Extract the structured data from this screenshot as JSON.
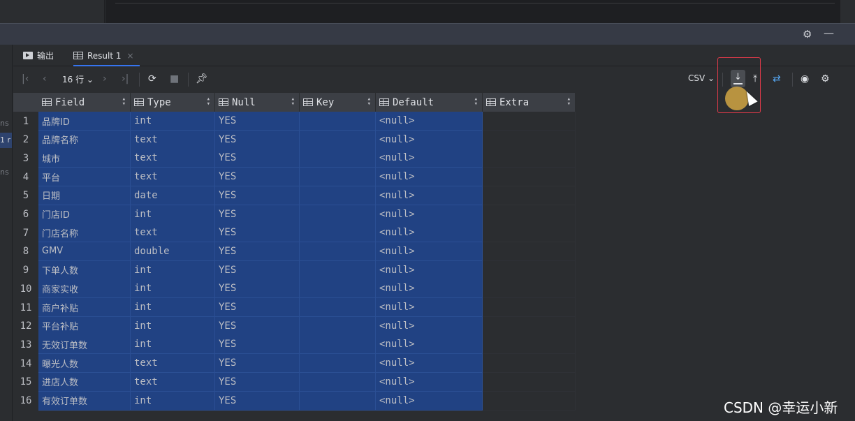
{
  "header": {
    "settings_icon": "gear-icon",
    "minimize_label": "—"
  },
  "tabs": [
    {
      "label": "输出",
      "icon": "console-icon"
    },
    {
      "label": "Result 1",
      "icon": "table-icon",
      "close": "×"
    }
  ],
  "toolbar": {
    "rows_label": "16 行",
    "format_label": "CSV"
  },
  "columns": [
    "Field",
    "Type",
    "Null",
    "Key",
    "Default",
    "Extra"
  ],
  "rows": [
    [
      "1",
      "品牌ID",
      "int",
      "YES",
      "",
      "<null>"
    ],
    [
      "2",
      "品牌名称",
      "text",
      "YES",
      "",
      "<null>"
    ],
    [
      "3",
      "城市",
      "text",
      "YES",
      "",
      "<null>"
    ],
    [
      "4",
      "平台",
      "text",
      "YES",
      "",
      "<null>"
    ],
    [
      "5",
      "日期",
      "date",
      "YES",
      "",
      "<null>"
    ],
    [
      "6",
      "门店ID",
      "int",
      "YES",
      "",
      "<null>"
    ],
    [
      "7",
      "门店名称",
      "text",
      "YES",
      "",
      "<null>"
    ],
    [
      "8",
      "GMV",
      "double",
      "YES",
      "",
      "<null>"
    ],
    [
      "9",
      "下单人数",
      "int",
      "YES",
      "",
      "<null>"
    ],
    [
      "10",
      "商家实收",
      "int",
      "YES",
      "",
      "<null>"
    ],
    [
      "11",
      "商户补贴",
      "int",
      "YES",
      "",
      "<null>"
    ],
    [
      "12",
      "平台补贴",
      "int",
      "YES",
      "",
      "<null>"
    ],
    [
      "13",
      "无效订单数",
      "int",
      "YES",
      "",
      "<null>"
    ],
    [
      "14",
      "曝光人数",
      "text",
      "YES",
      "",
      "<null>"
    ],
    [
      "15",
      "进店人数",
      "text",
      "YES",
      "",
      "<null>"
    ],
    [
      "16",
      "有效订单数",
      "int",
      "YES",
      "",
      "<null>"
    ]
  ],
  "left_fragments": [
    "ns",
    "1 r",
    "ns"
  ],
  "watermark": "CSDN @幸运小新",
  "colors": {
    "selection": "#214283",
    "accent": "#3574f0",
    "highlight_box": "#e03a4a"
  }
}
